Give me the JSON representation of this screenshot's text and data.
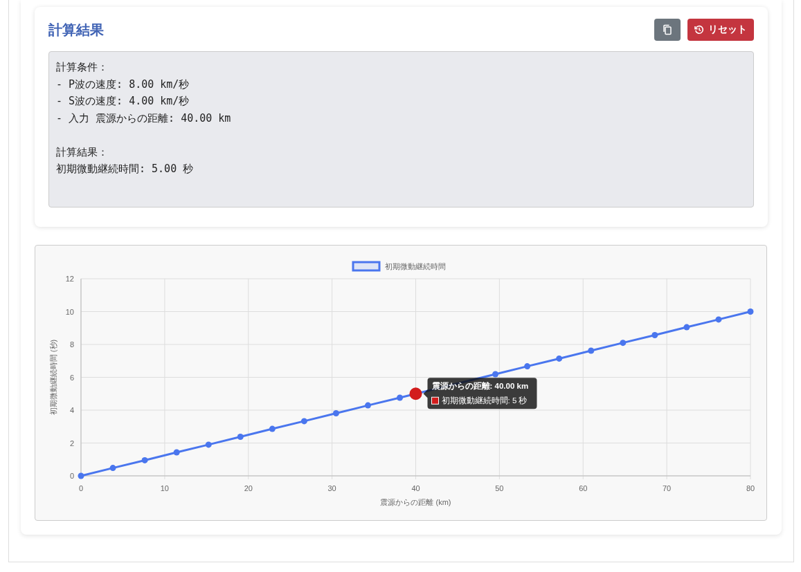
{
  "result_card": {
    "title": "計算結果",
    "reset_button": "リセット",
    "output_blocks": [
      [
        "計算条件：",
        "- P波の速度: 8.00 km/秒",
        "- S波の速度: 4.00 km/秒",
        "- 入力 震源からの距離: 40.00 km"
      ],
      [
        "計算結果：",
        "初期微動継続時間: 5.00 秒"
      ]
    ]
  },
  "chart": {
    "chart_data": {
      "type": "line",
      "xlabel": "震源からの距離 (km)",
      "ylabel": "初期微動継続時間 (秒)",
      "grid": true,
      "x": [
        0,
        3.81,
        7.62,
        11.43,
        15.24,
        19.05,
        22.86,
        26.67,
        30.48,
        34.29,
        38.1,
        41.9,
        45.71,
        49.52,
        53.33,
        57.14,
        60.95,
        64.76,
        68.57,
        72.38,
        76.19,
        80
      ],
      "series": [
        {
          "name": "初期微動継続時間",
          "color": "#4a76ee",
          "marker": "circle",
          "values": [
            0,
            0.48,
            0.95,
            1.43,
            1.9,
            2.38,
            2.86,
            3.33,
            3.81,
            4.29,
            4.76,
            null,
            null,
            6.19,
            6.67,
            7.14,
            7.62,
            8.1,
            8.57,
            9.05,
            9.52,
            10
          ]
        }
      ],
      "xlim": [
        0,
        80
      ],
      "ylim": [
        0,
        12
      ],
      "xticks": [
        0,
        10,
        20,
        30,
        40,
        50,
        60,
        70,
        80
      ],
      "yticks": [
        0,
        2,
        4,
        6,
        8,
        10,
        12
      ]
    },
    "tooltip": {
      "title": "震源からの距離: 40.00 km",
      "label": "初期微動継続時間: 5 秒",
      "color": "#d21c1c"
    }
  }
}
